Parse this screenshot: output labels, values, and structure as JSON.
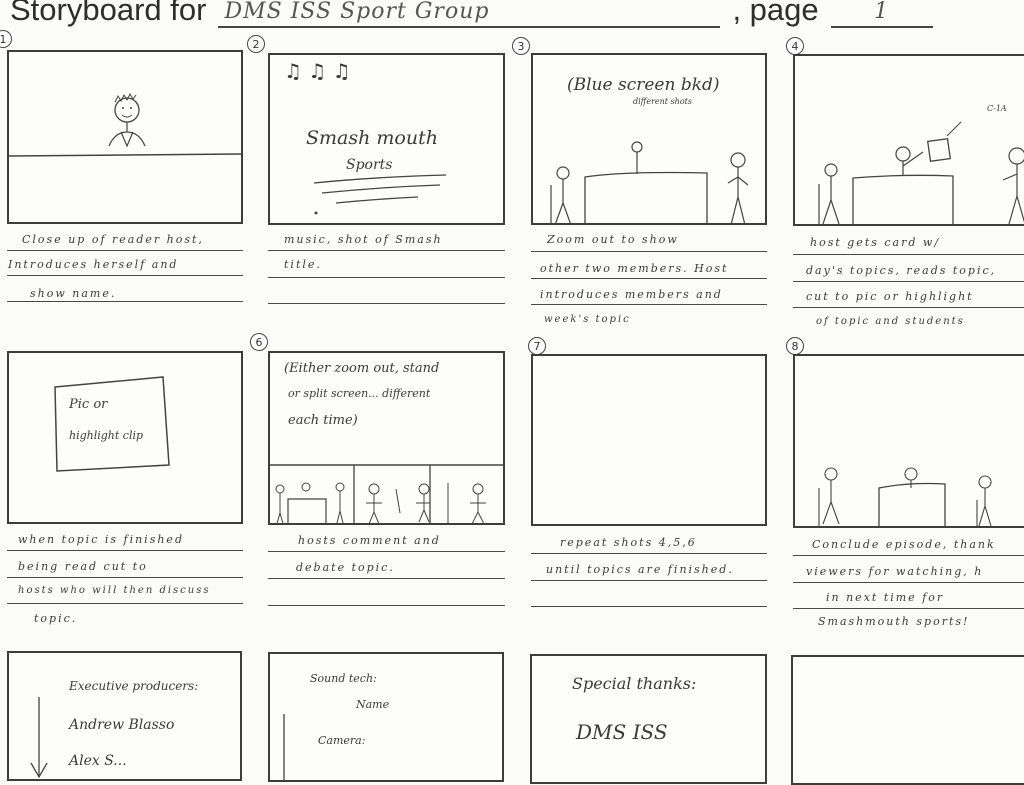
{
  "header": {
    "title": "Storyboard for",
    "group_value": "DMS ISS Sport Group",
    "page_label": ", page",
    "page_value": "1"
  },
  "panels": [
    {
      "number": "1",
      "sketch_text": [],
      "caption": [
        "Close up of reader host,",
        "Introduces herself and",
        "show name."
      ]
    },
    {
      "number": "2",
      "sketch_text": [
        "♫ ♫ ♫",
        "Smash mouth",
        "Sports"
      ],
      "caption": [
        "music, shot of Smash",
        "title."
      ]
    },
    {
      "number": "3",
      "sketch_text": [
        "(Blue screen bkd)",
        "different shots"
      ],
      "caption": [
        "Zoom out to show",
        "other two members. Host",
        "introduces members and",
        "week's topic"
      ]
    },
    {
      "number": "4",
      "sketch_text": [
        "C-1A"
      ],
      "caption": [
        "host gets card w/",
        "day's topics, reads topic,",
        "cut to pic or highlight",
        "of topic and students"
      ]
    },
    {
      "number": "5",
      "sketch_text": [
        "Pic or",
        "highlight clip"
      ],
      "caption": [
        "when topic is finished",
        "being read cut to",
        "hosts who will then discuss",
        "topic."
      ]
    },
    {
      "number": "6",
      "sketch_text": [
        "(Either zoom out, stand",
        "or split screen... different",
        "each time)"
      ],
      "caption": [
        "hosts comment and",
        "debate topic."
      ]
    },
    {
      "number": "7",
      "sketch_text": [],
      "caption": [
        "repeat shots 4,5,6",
        "until topics are finished."
      ]
    },
    {
      "number": "8",
      "sketch_text": [],
      "caption": [
        "Conclude episode, thank",
        "viewers for watching, h",
        "in next time for",
        "Smashmouth sports!"
      ]
    },
    {
      "number": "",
      "sketch_text": [
        "Executive producers:",
        "Andrew Blasso",
        "Alex S..."
      ],
      "caption": []
    },
    {
      "number": "",
      "sketch_text": [
        "Sound tech:",
        "Name",
        "Camera:"
      ],
      "caption": []
    },
    {
      "number": "",
      "sketch_text": [
        "Special thanks:",
        "DMS ISS"
      ],
      "caption": []
    },
    {
      "number": "",
      "sketch_text": [],
      "caption": []
    }
  ]
}
